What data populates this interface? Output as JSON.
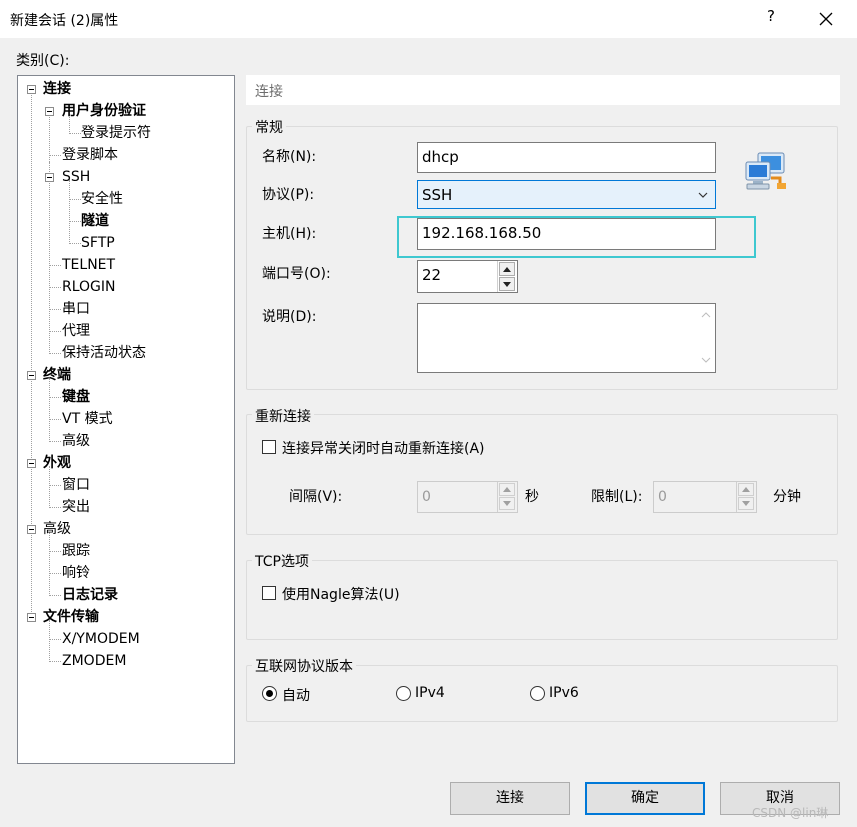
{
  "window": {
    "title": "新建会话 (2)属性",
    "help_label": "?",
    "close_icon": "close-icon"
  },
  "category_label": "类别(C):",
  "tree": {
    "connection": "连接",
    "auth": "用户身份验证",
    "login_prompt": "登录提示符",
    "login_script": "登录脚本",
    "ssh": "SSH",
    "security": "安全性",
    "tunnel": "隧道",
    "sftp": "SFTP",
    "telnet": "TELNET",
    "rlogin": "RLOGIN",
    "serial": "串口",
    "proxy": "代理",
    "keepalive": "保持活动状态",
    "terminal": "终端",
    "keyboard": "键盘",
    "vt_mode": "VT 模式",
    "advanced": "高级",
    "appearance": "外观",
    "window": "窗口",
    "highlight": "突出",
    "advanced2": "高级",
    "trace": "跟踪",
    "bell": "响铃",
    "logging": "日志记录",
    "file_transfer": "文件传输",
    "xymodem": "X/YMODEM",
    "zmodem": "ZMODEM"
  },
  "panel_header": "连接",
  "general": {
    "title": "常规",
    "name_label": "名称(N):",
    "name_value": "dhcp",
    "protocol_label": "协议(P):",
    "protocol_value": "SSH",
    "host_label": "主机(H):",
    "host_value": "192.168.168.50",
    "port_label": "端口号(O):",
    "port_value": "22",
    "desc_label": "说明(D):",
    "desc_value": ""
  },
  "reconnect": {
    "title": "重新连接",
    "checkbox_label": "连接异常关闭时自动重新连接(A)",
    "checked": false,
    "interval_label": "间隔(V):",
    "interval_value": "0",
    "seconds_unit": "秒",
    "limit_label": "限制(L):",
    "limit_value": "0",
    "minutes_unit": "分钟"
  },
  "tcp": {
    "title": "TCP选项",
    "nagle_label": "使用Nagle算法(U)",
    "checked": false
  },
  "ip_version": {
    "title": "互联网协议版本",
    "options": [
      "自动",
      "IPv4",
      "IPv6"
    ],
    "selected": "自动"
  },
  "buttons": {
    "connect": "连接",
    "ok": "确定",
    "cancel": "取消"
  },
  "colors": {
    "highlight_box": "#3ec8d0",
    "default_button_border": "#0078d7"
  },
  "watermark": "CSDN @lin琳"
}
